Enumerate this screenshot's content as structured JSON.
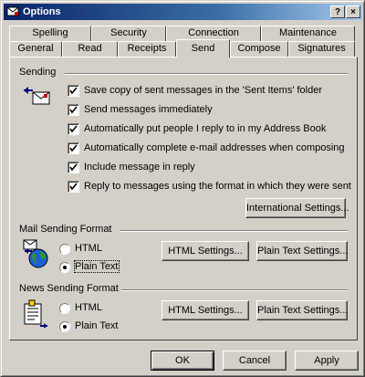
{
  "window": {
    "title": "Options",
    "help_label": "?",
    "close_label": "×"
  },
  "tabs": {
    "row1": [
      "Spelling",
      "Security",
      "Connection",
      "Maintenance"
    ],
    "row2": [
      "General",
      "Read",
      "Receipts",
      "Send",
      "Compose",
      "Signatures"
    ],
    "active": "Send"
  },
  "sending": {
    "label": "Sending",
    "options": [
      {
        "label": "Save copy of sent messages in the 'Sent Items' folder",
        "checked": true
      },
      {
        "label": "Send messages immediately",
        "checked": true
      },
      {
        "label": "Automatically put people I reply to in my Address Book",
        "checked": true
      },
      {
        "label": "Automatically complete e-mail addresses when composing",
        "checked": true
      },
      {
        "label": "Include message in reply",
        "checked": true
      },
      {
        "label": "Reply to messages using the format in which they were sent",
        "checked": true
      }
    ],
    "international_button": "International Settings..."
  },
  "mail_format": {
    "label": "Mail Sending Format",
    "html_label": "HTML",
    "plain_label": "Plain Text",
    "selected": "plain",
    "html_settings_button": "HTML Settings...",
    "plain_settings_button": "Plain Text Settings..."
  },
  "news_format": {
    "label": "News Sending Format",
    "html_label": "HTML",
    "plain_label": "Plain Text",
    "selected": "plain",
    "html_settings_button": "HTML Settings...",
    "plain_settings_button": "Plain Text Settings..."
  },
  "footer": {
    "ok": "OK",
    "cancel": "Cancel",
    "apply": "Apply"
  },
  "colors": {
    "title_start": "#0a246a",
    "title_end": "#a6caf0",
    "face": "#d4d0c8"
  }
}
